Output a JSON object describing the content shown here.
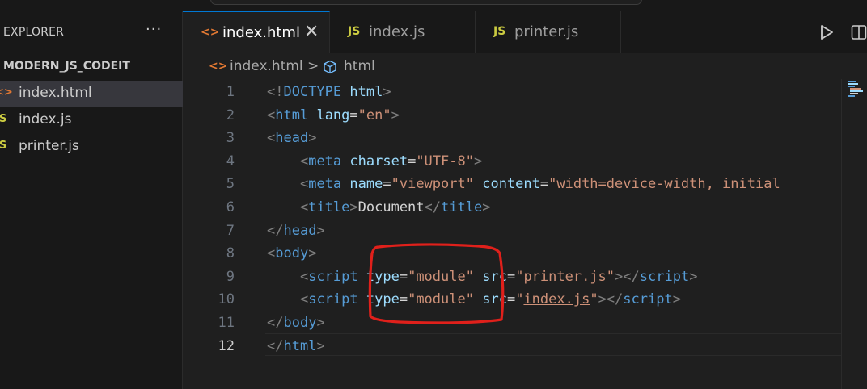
{
  "sidebar": {
    "title": "EXPLORER",
    "more": "···",
    "folder": "MODERN_JS_CODEIT",
    "files": [
      {
        "icon": "<>",
        "name": "index.html",
        "type": "html"
      },
      {
        "icon": "JS",
        "name": "index.js",
        "type": "js"
      },
      {
        "icon": "JS",
        "name": "printer.js",
        "type": "js"
      }
    ]
  },
  "tabs": [
    {
      "icon": "<>",
      "label": "index.html",
      "close": "✕"
    },
    {
      "icon": "JS",
      "label": "index.js"
    },
    {
      "icon": "JS",
      "label": "printer.js"
    }
  ],
  "breadcrumb": {
    "file_icon": "<>",
    "file": "index.html",
    "separator": ">",
    "symbol": "html"
  },
  "editor": {
    "current_line": 12,
    "lines": [
      {
        "n": "1",
        "parts": [
          [
            "t",
            "<!"
          ],
          [
            "tg",
            "DOCTYPE"
          ],
          [
            "tx",
            " "
          ],
          [
            "at",
            "html"
          ],
          [
            "t",
            ">"
          ]
        ]
      },
      {
        "n": "2",
        "parts": [
          [
            "t",
            "<"
          ],
          [
            "tg",
            "html"
          ],
          [
            "tx",
            " "
          ],
          [
            "at",
            "lang"
          ],
          [
            "tx",
            "="
          ],
          [
            "st",
            "\"en\""
          ],
          [
            "t",
            ">"
          ]
        ]
      },
      {
        "n": "3",
        "parts": [
          [
            "t",
            "<"
          ],
          [
            "tg",
            "head"
          ],
          [
            "t",
            ">"
          ]
        ]
      },
      {
        "n": "4",
        "parts": [
          [
            "tx",
            "    "
          ],
          [
            "t",
            "<"
          ],
          [
            "tg",
            "meta"
          ],
          [
            "tx",
            " "
          ],
          [
            "at",
            "charset"
          ],
          [
            "tx",
            "="
          ],
          [
            "st",
            "\"UTF-8\""
          ],
          [
            "t",
            ">"
          ]
        ]
      },
      {
        "n": "5",
        "parts": [
          [
            "tx",
            "    "
          ],
          [
            "t",
            "<"
          ],
          [
            "tg",
            "meta"
          ],
          [
            "tx",
            " "
          ],
          [
            "at",
            "name"
          ],
          [
            "tx",
            "="
          ],
          [
            "st",
            "\"viewport\""
          ],
          [
            "tx",
            " "
          ],
          [
            "at",
            "content"
          ],
          [
            "tx",
            "="
          ],
          [
            "st",
            "\"width=device-width, initial"
          ]
        ]
      },
      {
        "n": "6",
        "parts": [
          [
            "tx",
            "    "
          ],
          [
            "t",
            "<"
          ],
          [
            "tg",
            "title"
          ],
          [
            "t",
            ">"
          ],
          [
            "tx",
            "Document"
          ],
          [
            "t",
            "</"
          ],
          [
            "tg",
            "title"
          ],
          [
            "t",
            ">"
          ]
        ]
      },
      {
        "n": "7",
        "parts": [
          [
            "t",
            "</"
          ],
          [
            "tg",
            "head"
          ],
          [
            "t",
            ">"
          ]
        ]
      },
      {
        "n": "8",
        "parts": [
          [
            "t",
            "<"
          ],
          [
            "tg",
            "body"
          ],
          [
            "t",
            ">"
          ]
        ]
      },
      {
        "n": "9",
        "parts": [
          [
            "tx",
            "    "
          ],
          [
            "t",
            "<"
          ],
          [
            "tg",
            "script"
          ],
          [
            "tx",
            " "
          ],
          [
            "at",
            "type"
          ],
          [
            "tx",
            "="
          ],
          [
            "st",
            "\"module\""
          ],
          [
            "tx",
            " "
          ],
          [
            "at",
            "src"
          ],
          [
            "tx",
            "="
          ],
          [
            "st",
            "\""
          ],
          [
            "stu",
            "printer.js"
          ],
          [
            "st",
            "\""
          ],
          [
            "t",
            "></"
          ],
          [
            "tg",
            "script"
          ],
          [
            "t",
            ">"
          ]
        ]
      },
      {
        "n": "10",
        "parts": [
          [
            "tx",
            "    "
          ],
          [
            "t",
            "<"
          ],
          [
            "tg",
            "script"
          ],
          [
            "tx",
            " "
          ],
          [
            "at",
            "type"
          ],
          [
            "tx",
            "="
          ],
          [
            "st",
            "\"module\""
          ],
          [
            "tx",
            " "
          ],
          [
            "at",
            "src"
          ],
          [
            "tx",
            "="
          ],
          [
            "st",
            "\""
          ],
          [
            "stu",
            "index.js"
          ],
          [
            "st",
            "\""
          ],
          [
            "t",
            "></"
          ],
          [
            "tg",
            "script"
          ],
          [
            "t",
            ">"
          ]
        ]
      },
      {
        "n": "11",
        "parts": [
          [
            "t",
            "</"
          ],
          [
            "tg",
            "body"
          ],
          [
            "t",
            ">"
          ]
        ]
      },
      {
        "n": "12",
        "parts": [
          [
            "t",
            "</"
          ],
          [
            "tg",
            "html"
          ],
          [
            "t",
            ">"
          ]
        ]
      }
    ]
  },
  "annotation": {
    "color": "#e0201b"
  },
  "colors": {
    "accent": "#0078d4",
    "html_icon": "#e37933",
    "js_icon": "#cbcb41"
  }
}
